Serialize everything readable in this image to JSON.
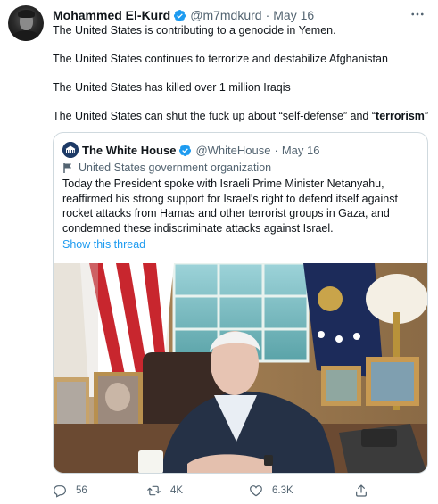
{
  "author": {
    "name": "Mohammed El-Kurd",
    "handle": "@m7mdkurd",
    "separator": "·",
    "date": "May 16"
  },
  "body": {
    "line1": "The United States is contributing to a genocide in Yemen.",
    "line2": "The United States continues to terrorize and destabilize Afghanistan",
    "line3": "The United States has killed over 1 million Iraqis",
    "line4_prefix": "The United States can shut the fuck up about “self-defense” and “",
    "line4_bold": "terrorism",
    "line4_suffix": "”"
  },
  "quoted": {
    "name": "The White House",
    "handle": "@WhiteHouse",
    "separator": "·",
    "date": "May 16",
    "org_label": "United States government organization",
    "text": "Today the President spoke with Israeli Prime Minister Netanyahu, reaffirmed his strong support for Israel's right to defend itself against rocket attacks from Hamas and other terrorist groups in Gaza, and condemned these indiscriminate attacks against Israel.",
    "show_thread": "Show this thread"
  },
  "actions": {
    "replies": "56",
    "retweets": "4K",
    "likes": "6.3K"
  },
  "colors": {
    "accent": "#1d9bf0",
    "muted": "#536471",
    "border": "#cfd9de"
  },
  "icons": [
    "verified-badge-icon",
    "more-icon",
    "white-house-logo-icon",
    "flag-icon",
    "reply-icon",
    "retweet-icon",
    "like-icon",
    "share-icon"
  ]
}
